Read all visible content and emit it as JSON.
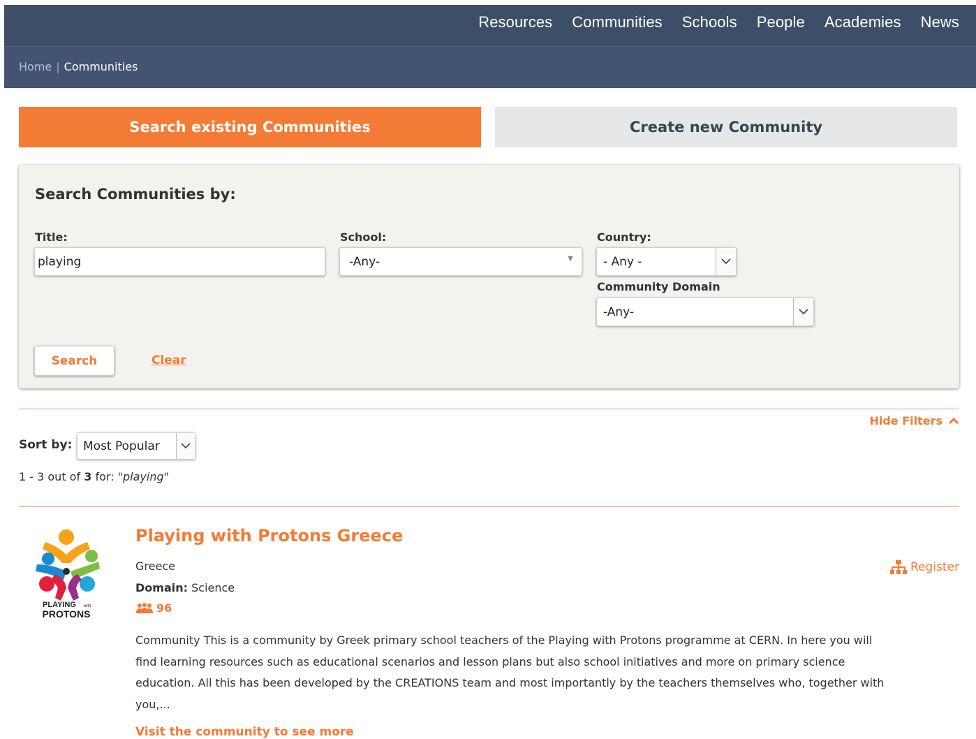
{
  "nav": {
    "items": [
      "Resources",
      "Communities",
      "Schools",
      "People",
      "Academies",
      "News"
    ]
  },
  "breadcrumb": {
    "home": "Home",
    "separator": "|",
    "current": "Communities"
  },
  "tabs": {
    "search": "Search existing Communities",
    "create": "Create new Community"
  },
  "filters": {
    "heading": "Search Communities by:",
    "title_label": "Title:",
    "title_value": "playing",
    "school_label": "School:",
    "school_value": "-Any-",
    "country_label": "Country:",
    "country_value": "- Any -",
    "domain_label": "Community Domain",
    "domain_value": "-Any-",
    "search_button": "Search",
    "clear_link": "Clear"
  },
  "hide_filters": "Hide Filters",
  "sort": {
    "label": "Sort by:",
    "value": "Most Popular"
  },
  "results": {
    "range": "1 - 3 out of",
    "total": "3",
    "for": "for:",
    "query": "\"playing\""
  },
  "community": {
    "title": "Playing with Protons Greece",
    "country": "Greece",
    "domain_label": "Domain:",
    "domain_value": "Science",
    "members": "96",
    "description": "Community This is a community by Greek primary school teachers of the Playing with Protons programme at CERN. In here you will find learning resources such as educational scenarios and lesson plans but also school initiatives and more on primary science education. All this has been developed by the CREATIONS team and most importantly by the teachers themselves who, together with you,...",
    "visit_link": "Visit the community to see more",
    "register": "Register",
    "logo_text_line1": "PLAYING",
    "logo_text_small": "with",
    "logo_text_line2": "PROTONS"
  },
  "colors": {
    "accent": "#f47b35",
    "nav": "#3d4f68",
    "crumb": "#435472"
  }
}
